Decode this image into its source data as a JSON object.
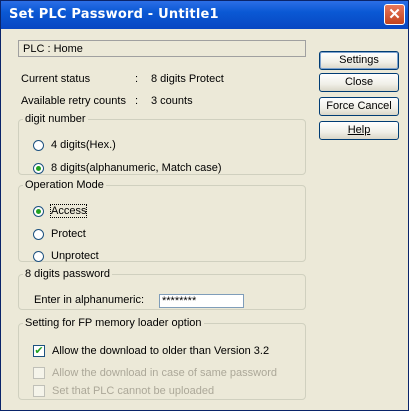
{
  "window": {
    "title": "Set PLC Password - Untitle1",
    "close_glyph": "✕"
  },
  "plc": {
    "label": "PLC : Home"
  },
  "status": {
    "current_label": "Current status",
    "current_value": "8 digits Protect",
    "retry_label": "Available retry counts",
    "retry_value": "3 counts",
    "colon": ":"
  },
  "digit_number": {
    "legend": "digit number",
    "options": [
      "4 digits(Hex.)",
      "8 digits(alphanumeric, Match case)"
    ],
    "selected": 1
  },
  "operation_mode": {
    "legend": "Operation Mode",
    "options": [
      "Access",
      "Protect",
      "Unprotect"
    ],
    "selected": 0
  },
  "password": {
    "legend": "8 digits password",
    "label": "Enter in alphanumeric:",
    "value": "********"
  },
  "fp_loader": {
    "legend": "Setting for FP memory loader option",
    "options": [
      {
        "label": "Allow the download to older than Version 3.2",
        "checked": true,
        "enabled": true
      },
      {
        "label": "Allow the download in case of same password",
        "checked": false,
        "enabled": false
      },
      {
        "label": "Set that PLC cannot be uploaded",
        "checked": false,
        "enabled": false
      }
    ]
  },
  "buttons": {
    "settings": "Settings",
    "close": "Close",
    "force_cancel": "Force Cancel",
    "help": "Help"
  },
  "icons": {
    "close": "close-icon",
    "check": "check-icon"
  }
}
